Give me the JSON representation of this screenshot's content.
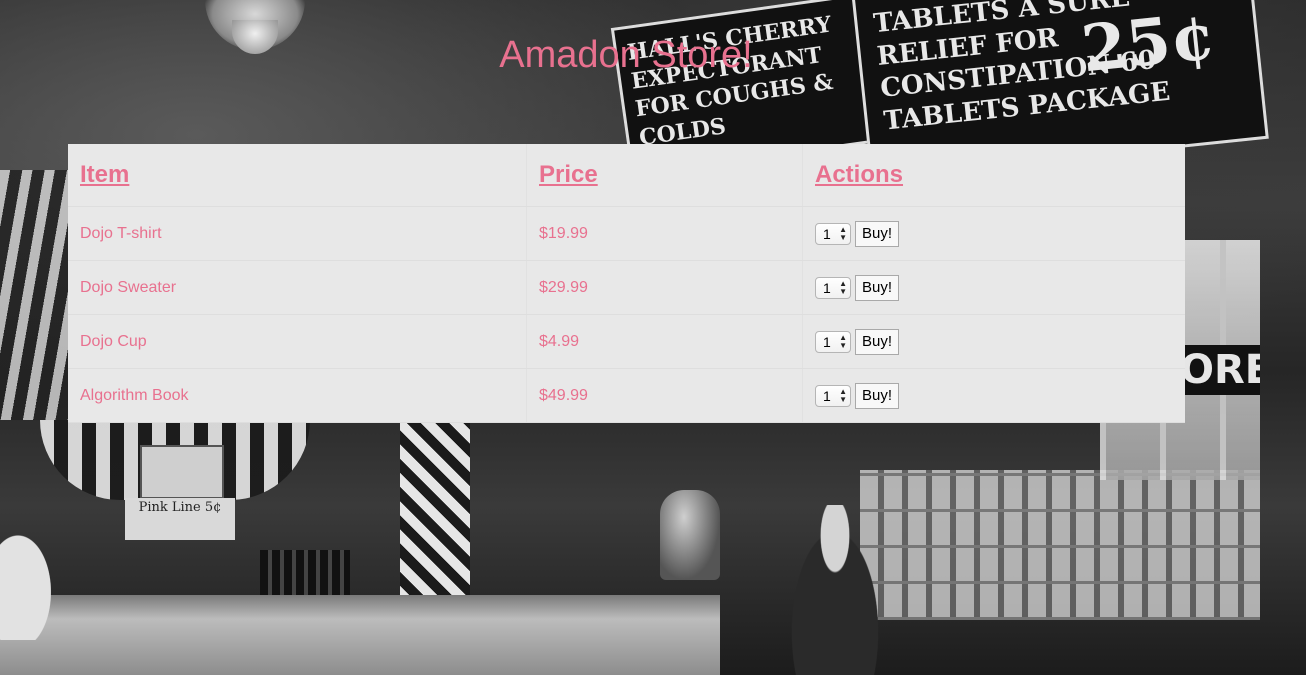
{
  "header": {
    "title": "Amadon Store!"
  },
  "table": {
    "columns": [
      "Item",
      "Price",
      "Actions"
    ],
    "rows": [
      {
        "item": "Dojo T-shirt",
        "price": "$19.99",
        "qty": "1",
        "action": "Buy!"
      },
      {
        "item": "Dojo Sweater",
        "price": "$29.99",
        "qty": "1",
        "action": "Buy!"
      },
      {
        "item": "Dojo Cup",
        "price": "$4.99",
        "qty": "1",
        "action": "Buy!"
      },
      {
        "item": "Algorithm Book",
        "price": "$49.99",
        "qty": "1",
        "action": "Buy!"
      }
    ]
  },
  "background": {
    "sign_left_text": "HALL'S CHERRY EXPECTORANT FOR COUGHS & COLDS",
    "sign_right_text": "TABLETS A SURE RELIEF FOR CONSTIPATION 60 TABLETS PACKAGE",
    "sign_right_price": "25¢",
    "store_sign_text": "ORE",
    "small_sign_text": "Pink Line 5¢"
  },
  "colors": {
    "accent": "#e8718f",
    "table_bg": "#e8e8e8"
  }
}
